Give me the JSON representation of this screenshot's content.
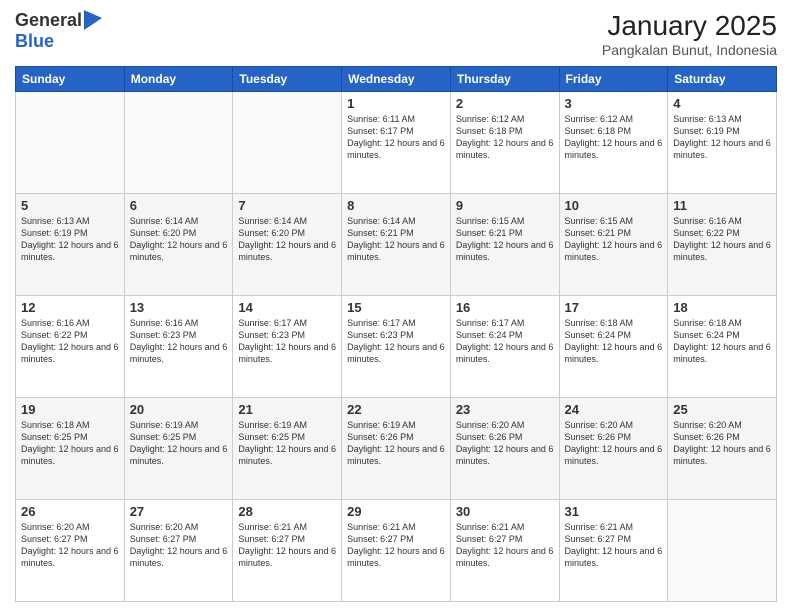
{
  "logo": {
    "line1": "General",
    "line2": "Blue"
  },
  "header": {
    "title": "January 2025",
    "subtitle": "Pangkalan Bunut, Indonesia"
  },
  "days_of_week": [
    "Sunday",
    "Monday",
    "Tuesday",
    "Wednesday",
    "Thursday",
    "Friday",
    "Saturday"
  ],
  "weeks": [
    [
      {
        "day": "",
        "info": ""
      },
      {
        "day": "",
        "info": ""
      },
      {
        "day": "",
        "info": ""
      },
      {
        "day": "1",
        "info": "Sunrise: 6:11 AM\nSunset: 6:17 PM\nDaylight: 12 hours and 6 minutes."
      },
      {
        "day": "2",
        "info": "Sunrise: 6:12 AM\nSunset: 6:18 PM\nDaylight: 12 hours and 6 minutes."
      },
      {
        "day": "3",
        "info": "Sunrise: 6:12 AM\nSunset: 6:18 PM\nDaylight: 12 hours and 6 minutes."
      },
      {
        "day": "4",
        "info": "Sunrise: 6:13 AM\nSunset: 6:19 PM\nDaylight: 12 hours and 6 minutes."
      }
    ],
    [
      {
        "day": "5",
        "info": "Sunrise: 6:13 AM\nSunset: 6:19 PM\nDaylight: 12 hours and 6 minutes."
      },
      {
        "day": "6",
        "info": "Sunrise: 6:14 AM\nSunset: 6:20 PM\nDaylight: 12 hours and 6 minutes."
      },
      {
        "day": "7",
        "info": "Sunrise: 6:14 AM\nSunset: 6:20 PM\nDaylight: 12 hours and 6 minutes."
      },
      {
        "day": "8",
        "info": "Sunrise: 6:14 AM\nSunset: 6:21 PM\nDaylight: 12 hours and 6 minutes."
      },
      {
        "day": "9",
        "info": "Sunrise: 6:15 AM\nSunset: 6:21 PM\nDaylight: 12 hours and 6 minutes."
      },
      {
        "day": "10",
        "info": "Sunrise: 6:15 AM\nSunset: 6:21 PM\nDaylight: 12 hours and 6 minutes."
      },
      {
        "day": "11",
        "info": "Sunrise: 6:16 AM\nSunset: 6:22 PM\nDaylight: 12 hours and 6 minutes."
      }
    ],
    [
      {
        "day": "12",
        "info": "Sunrise: 6:16 AM\nSunset: 6:22 PM\nDaylight: 12 hours and 6 minutes."
      },
      {
        "day": "13",
        "info": "Sunrise: 6:16 AM\nSunset: 6:23 PM\nDaylight: 12 hours and 6 minutes."
      },
      {
        "day": "14",
        "info": "Sunrise: 6:17 AM\nSunset: 6:23 PM\nDaylight: 12 hours and 6 minutes."
      },
      {
        "day": "15",
        "info": "Sunrise: 6:17 AM\nSunset: 6:23 PM\nDaylight: 12 hours and 6 minutes."
      },
      {
        "day": "16",
        "info": "Sunrise: 6:17 AM\nSunset: 6:24 PM\nDaylight: 12 hours and 6 minutes."
      },
      {
        "day": "17",
        "info": "Sunrise: 6:18 AM\nSunset: 6:24 PM\nDaylight: 12 hours and 6 minutes."
      },
      {
        "day": "18",
        "info": "Sunrise: 6:18 AM\nSunset: 6:24 PM\nDaylight: 12 hours and 6 minutes."
      }
    ],
    [
      {
        "day": "19",
        "info": "Sunrise: 6:18 AM\nSunset: 6:25 PM\nDaylight: 12 hours and 6 minutes."
      },
      {
        "day": "20",
        "info": "Sunrise: 6:19 AM\nSunset: 6:25 PM\nDaylight: 12 hours and 6 minutes."
      },
      {
        "day": "21",
        "info": "Sunrise: 6:19 AM\nSunset: 6:25 PM\nDaylight: 12 hours and 6 minutes."
      },
      {
        "day": "22",
        "info": "Sunrise: 6:19 AM\nSunset: 6:26 PM\nDaylight: 12 hours and 6 minutes."
      },
      {
        "day": "23",
        "info": "Sunrise: 6:20 AM\nSunset: 6:26 PM\nDaylight: 12 hours and 6 minutes."
      },
      {
        "day": "24",
        "info": "Sunrise: 6:20 AM\nSunset: 6:26 PM\nDaylight: 12 hours and 6 minutes."
      },
      {
        "day": "25",
        "info": "Sunrise: 6:20 AM\nSunset: 6:26 PM\nDaylight: 12 hours and 6 minutes."
      }
    ],
    [
      {
        "day": "26",
        "info": "Sunrise: 6:20 AM\nSunset: 6:27 PM\nDaylight: 12 hours and 6 minutes."
      },
      {
        "day": "27",
        "info": "Sunrise: 6:20 AM\nSunset: 6:27 PM\nDaylight: 12 hours and 6 minutes."
      },
      {
        "day": "28",
        "info": "Sunrise: 6:21 AM\nSunset: 6:27 PM\nDaylight: 12 hours and 6 minutes."
      },
      {
        "day": "29",
        "info": "Sunrise: 6:21 AM\nSunset: 6:27 PM\nDaylight: 12 hours and 6 minutes."
      },
      {
        "day": "30",
        "info": "Sunrise: 6:21 AM\nSunset: 6:27 PM\nDaylight: 12 hours and 6 minutes."
      },
      {
        "day": "31",
        "info": "Sunrise: 6:21 AM\nSunset: 6:27 PM\nDaylight: 12 hours and 6 minutes."
      },
      {
        "day": "",
        "info": ""
      }
    ]
  ]
}
